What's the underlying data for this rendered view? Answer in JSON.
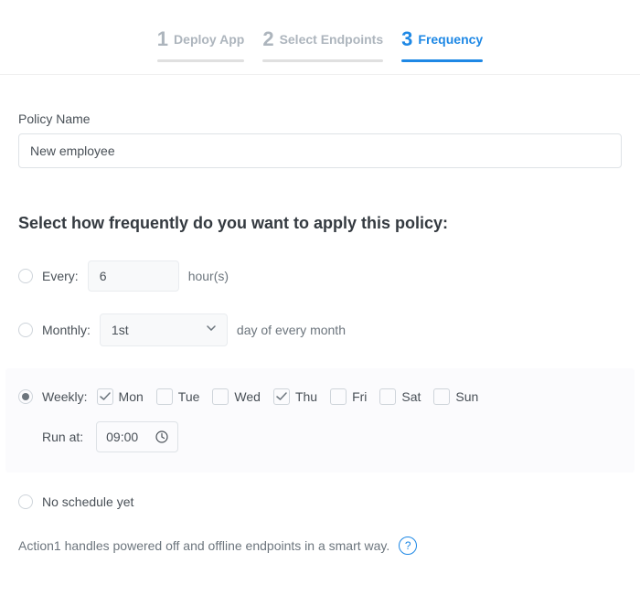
{
  "stepper": {
    "steps": [
      {
        "number": "1",
        "label": "Deploy App"
      },
      {
        "number": "2",
        "label": "Select Endpoints"
      },
      {
        "number": "3",
        "label": "Frequency"
      }
    ],
    "active_index": 2
  },
  "policy_section": {
    "label": "Policy Name",
    "value": "New employee"
  },
  "frequency": {
    "title": "Select how frequently do you want to apply this policy:",
    "options": {
      "every": {
        "label": "Every:",
        "value": "6",
        "suffix": "hour(s)"
      },
      "monthly": {
        "label": "Monthly:",
        "value": "1st",
        "suffix": "day of every month"
      },
      "weekly": {
        "label": "Weekly:",
        "days": [
          {
            "short": "Mon",
            "checked": true
          },
          {
            "short": "Tue",
            "checked": false
          },
          {
            "short": "Wed",
            "checked": false
          },
          {
            "short": "Thu",
            "checked": true
          },
          {
            "short": "Fri",
            "checked": false
          },
          {
            "short": "Sat",
            "checked": false
          },
          {
            "short": "Sun",
            "checked": false
          }
        ],
        "run_at_label": "Run at:",
        "run_at_value": "09:00"
      },
      "none": {
        "label": "No schedule yet"
      }
    },
    "selected": "weekly"
  },
  "footer": {
    "note": "Action1 handles powered off and offline endpoints in a smart way.",
    "help": "?"
  }
}
